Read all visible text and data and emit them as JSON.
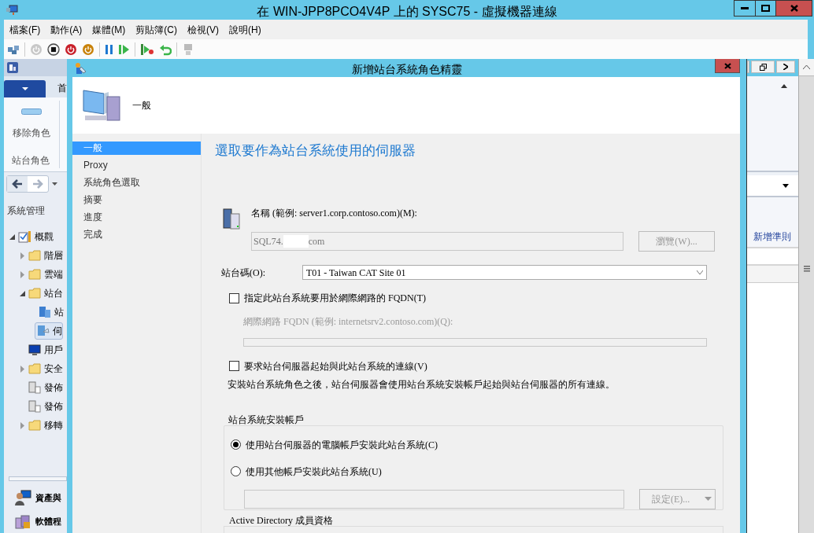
{
  "window": {
    "title": "在 WIN-JPP8PCO4V4P 上的 SYSC75 - 虛擬機器連線"
  },
  "menu": [
    "檔案(F)",
    "動作(A)",
    "媒體(M)",
    "剪貼簿(C)",
    "檢視(V)",
    "說明(H)"
  ],
  "console": {
    "ribbon_tab": "首",
    "ribbon_button": "移除角色",
    "ribbon_group": "站台角色",
    "nav_title": "系統管理",
    "tree": [
      {
        "label": "概觀",
        "kind": "overview",
        "expanded": true,
        "selected": false,
        "children": [
          {
            "label": "階層",
            "kind": "folder",
            "expanded": false,
            "selected": false
          },
          {
            "label": "雲端",
            "kind": "folder",
            "expanded": false,
            "selected": false
          },
          {
            "label": "站台",
            "kind": "folder",
            "expanded": true,
            "selected": false,
            "children": [
              {
                "label": "站",
                "kind": "sites",
                "selected": false
              },
              {
                "label": "伺",
                "kind": "servers",
                "selected": true
              }
            ]
          },
          {
            "label": "用戶",
            "kind": "monitor",
            "selected": false
          },
          {
            "label": "安全",
            "kind": "folder",
            "expanded": false,
            "selected": false
          },
          {
            "label": "發佈",
            "kind": "publish",
            "selected": false
          },
          {
            "label": "發佈",
            "kind": "publish",
            "selected": false
          },
          {
            "label": "移轉",
            "kind": "folder",
            "expanded": false,
            "selected": false
          }
        ]
      }
    ],
    "workspaces": [
      {
        "label": "資產與",
        "kind": "person"
      },
      {
        "label": "軟體程",
        "kind": "library"
      }
    ],
    "action": "新增準則"
  },
  "dialog": {
    "title": "新增站台系統角色精靈",
    "header": "一般",
    "steps": [
      {
        "label": "一般",
        "selected": true
      },
      {
        "label": "Proxy",
        "selected": false
      },
      {
        "label": "系統角色選取",
        "selected": false
      },
      {
        "label": "摘要",
        "selected": false
      },
      {
        "label": "進度",
        "selected": false
      },
      {
        "label": "完成",
        "selected": false
      }
    ],
    "heading": "選取要作為站台系統使用的伺服器",
    "name_label": "名稱 (範例: server1.corp.contoso.com)(M):",
    "name_field": {
      "value_start": "SQL74.",
      "value_end": "com"
    },
    "browse_button": {
      "label": "瀏覽(W)...",
      "disabled": true
    },
    "site_code_label": "站台碼(O):",
    "site_code": "T01 - Taiwan CAT Site 01",
    "internet_fqdn": {
      "label": "指定此站台系統要用於網際網路的 FQDN(T)",
      "checked": false
    },
    "fqdn_label": "網際網路 FQDN (範例: internetsrv2.contoso.com)(Q):",
    "require_connection": {
      "label": "要求站台伺服器起始與此站台系統的連線(V)",
      "checked": false
    },
    "note": "安裝站台系統角色之後，站台伺服器會使用站台系統安裝帳戶起始與站台伺服器的所有連線。",
    "install_account": {
      "title": "站台系統安裝帳戶",
      "options": [
        {
          "label": "使用站台伺服器的電腦帳戶安裝此站台系統(C)",
          "selected": true
        },
        {
          "label": "使用其他帳戶安裝此站台系統(U)",
          "selected": false
        }
      ],
      "set_button": {
        "label": "設定(E)...",
        "disabled": true
      }
    },
    "ad_group": {
      "title": "Active Directory 成員資格"
    }
  }
}
